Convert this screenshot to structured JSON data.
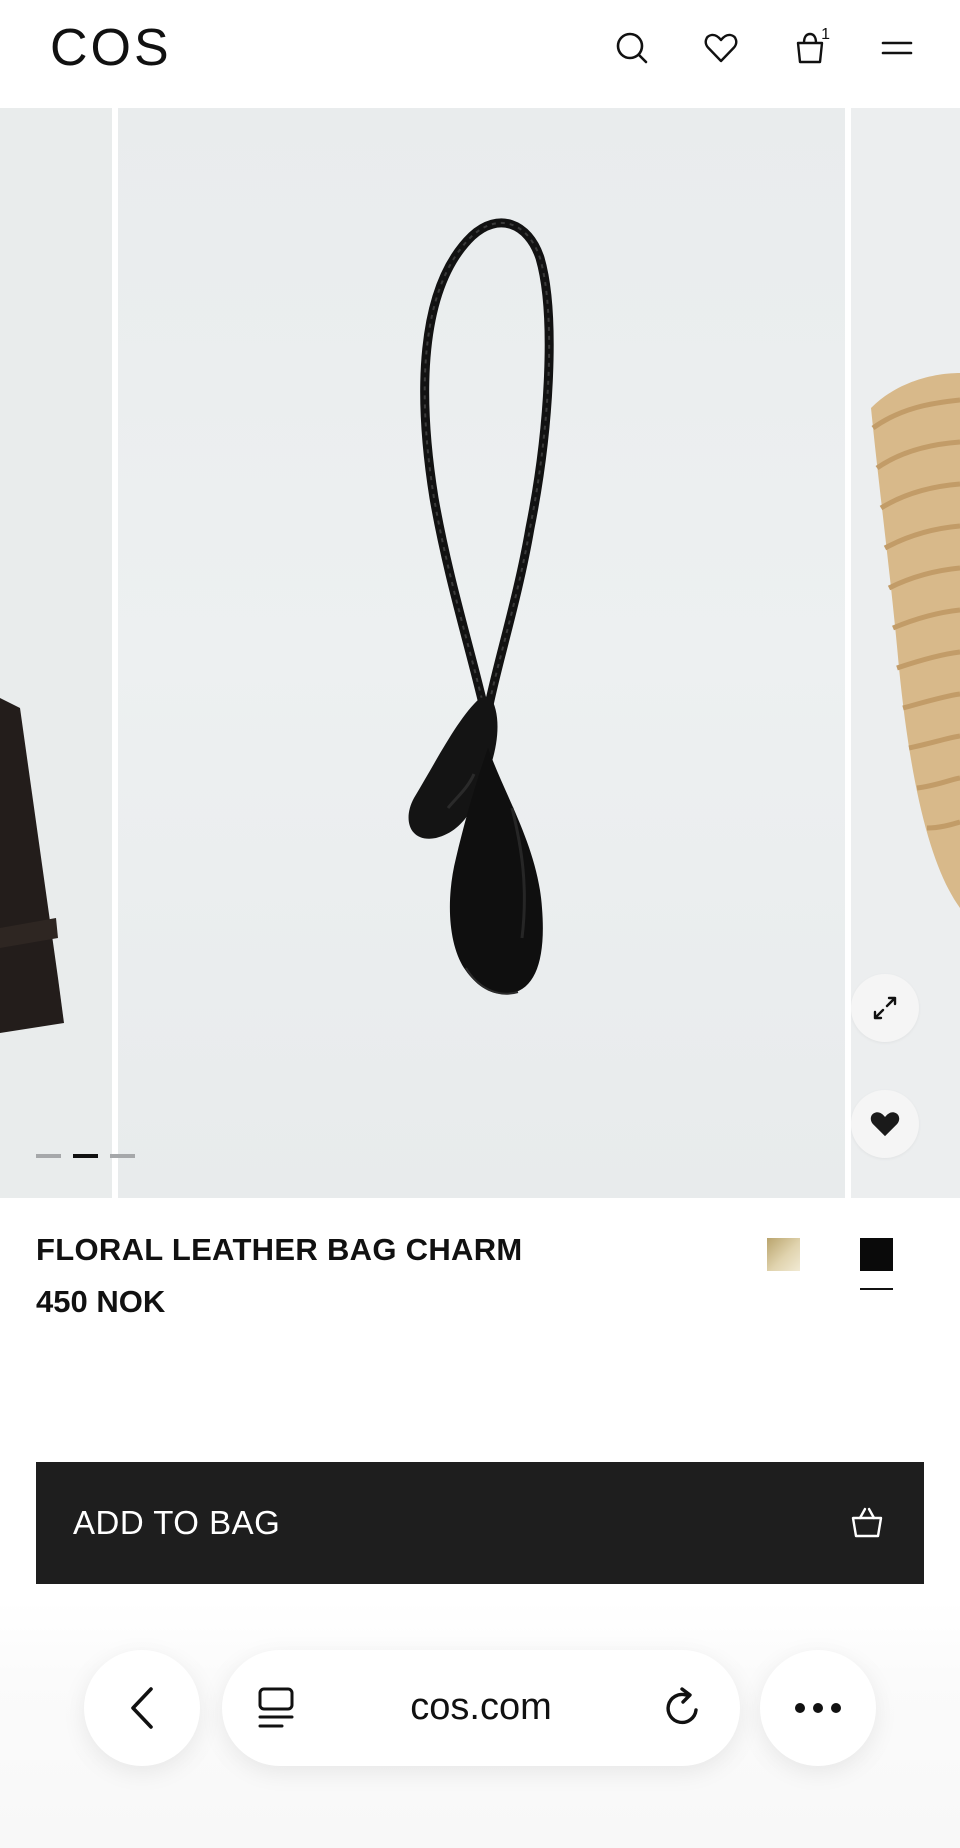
{
  "header": {
    "logo": "COS",
    "bag_count": "1",
    "icons": [
      "search-icon",
      "heart-icon",
      "bag-icon",
      "menu-icon"
    ]
  },
  "carousel": {
    "slide_count": 3,
    "active_slide": 2,
    "icons": [
      "expand-icon",
      "heart-filled-icon"
    ]
  },
  "product": {
    "name": "FLORAL LEATHER BAG CHARM",
    "price": "450 NOK",
    "swatches": [
      {
        "name": "beige",
        "color": "#c9b98a",
        "selected": false
      },
      {
        "name": "black",
        "color": "#0a0a0a",
        "selected": true
      }
    ]
  },
  "cta": {
    "label": "ADD TO BAG",
    "icon": "basket-icon"
  },
  "browser": {
    "url": "cos.com",
    "icons": [
      "back-icon",
      "tabs-icon",
      "reload-icon",
      "more-icon"
    ]
  },
  "colors": {
    "button_bg": "#1e1e1e",
    "image_bg": "#eceff0",
    "text": "#111111"
  }
}
